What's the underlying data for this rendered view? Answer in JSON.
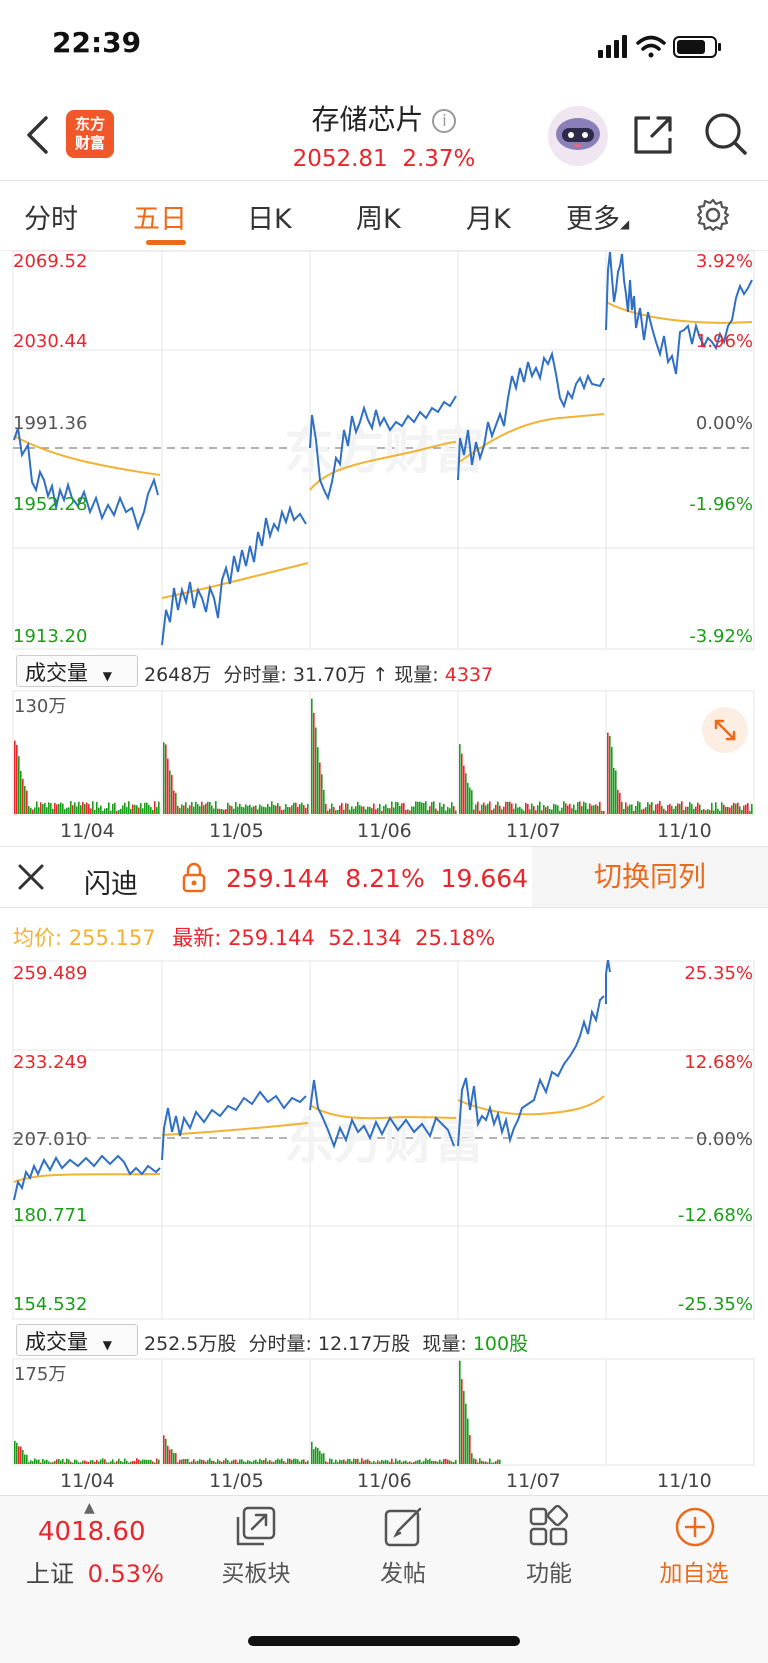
{
  "status": {
    "time": "22:39"
  },
  "header": {
    "logo_line1": "东方",
    "logo_line2": "财富",
    "title": "存储芯片",
    "price": "2052.81",
    "change_pct": "2.37%"
  },
  "tabs": [
    "分时",
    "五日",
    "日K",
    "周K",
    "月K",
    "更多"
  ],
  "active_tab": "五日",
  "chart1": {
    "y_left": [
      "2069.52",
      "2030.44",
      "1991.36",
      "1952.28",
      "1913.20"
    ],
    "y_right": [
      "3.92%",
      "1.96%",
      "0.00%",
      "-1.96%",
      "-3.92%"
    ],
    "volume": {
      "select_label": "成交量",
      "total": "2648万",
      "minute_label": "分时量:",
      "minute_value": "31.70万",
      "current_label": "现量:",
      "current_value": "4337",
      "max_label": "130万"
    },
    "dates": [
      "11/04",
      "11/05",
      "11/06",
      "11/07",
      "11/10"
    ]
  },
  "compare": {
    "name": "闪迪",
    "price": "259.144",
    "pct": "8.21%",
    "change": "19.664",
    "switch_button": "切换同列",
    "avg_label": "均价:",
    "avg_value": "255.157",
    "latest_label": "最新:",
    "latest_price": "259.144",
    "latest_change": "52.134",
    "latest_pct": "25.18%"
  },
  "chart2": {
    "y_left": [
      "259.489",
      "233.249",
      "207.010",
      "180.771",
      "154.532"
    ],
    "y_right": [
      "25.35%",
      "12.68%",
      "0.00%",
      "-12.68%",
      "-25.35%"
    ],
    "volume": {
      "select_label": "成交量",
      "total": "252.5万股",
      "minute_label": "分时量:",
      "minute_value": "12.17万股",
      "current_label": "现量:",
      "current_value": "100股",
      "max_label": "175万"
    },
    "dates": [
      "11/04",
      "11/05",
      "11/06",
      "11/07",
      "11/10"
    ]
  },
  "watermark": "东方财富",
  "bottom": {
    "index_value": "4018.60",
    "index_name": "上证",
    "index_pct": "0.53%",
    "buttons": [
      "买板块",
      "发帖",
      "功能",
      "加自选"
    ]
  },
  "colors": {
    "accent": "#ee6a1b",
    "up": "#e8262b",
    "down": "#1a9e1a",
    "price_line": "#2f6fc5",
    "avg_line": "#f2b233"
  }
}
